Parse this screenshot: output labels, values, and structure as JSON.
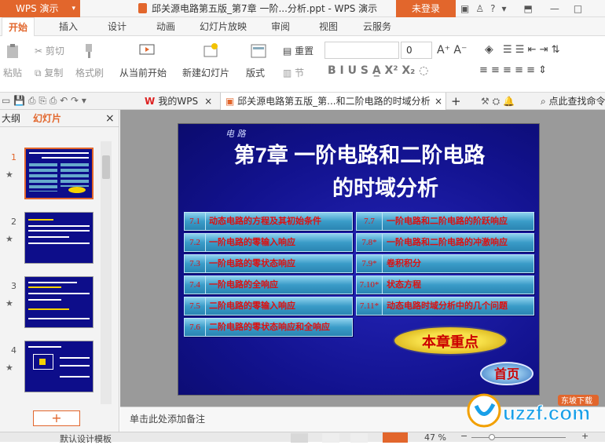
{
  "app": {
    "name": "WPS 演示",
    "doc_title": "邱关源电路第五版_第7章 一阶...分析.ppt - WPS 演示",
    "login": "未登录"
  },
  "menu": {
    "tabs": [
      "开始",
      "插入",
      "设计",
      "动画",
      "幻灯片放映",
      "审阅",
      "视图",
      "云服务"
    ]
  },
  "ribbon": {
    "paste": "粘贴",
    "cut": "剪切",
    "copy": "复制",
    "format_painter": "格式刷",
    "from_current": "从当前开始",
    "new_slide": "新建幻灯片",
    "layout": "版式",
    "reset": "重置",
    "section": "节",
    "font_name": "",
    "font_size": "0"
  },
  "quickbar": {
    "tab_wps": "我的WPS",
    "tab_doc": "邱关源电路第五版_第...和二阶电路的时域分析",
    "search": "点此查找命令"
  },
  "left_panel": {
    "tab_outline": "大纲",
    "tab_slides": "幻灯片",
    "slide_numbers": [
      "1",
      "2",
      "3",
      "4"
    ],
    "star": "★",
    "add": "+"
  },
  "slide": {
    "deco": "电 路",
    "title_line1": "第7章 一阶电路和二阶电路",
    "title_line2": "的时域分析",
    "left_items": [
      {
        "num": "7.1",
        "label": "动态电路的方程及其初始条件"
      },
      {
        "num": "7.2",
        "label": "一阶电路的零输入响应"
      },
      {
        "num": "7.3",
        "label": "一阶电路的零状态响应"
      },
      {
        "num": "7.4",
        "label": "一阶电路的全响应"
      },
      {
        "num": "7.5",
        "label": "二阶电路的零输入响应"
      },
      {
        "num": "7.6",
        "label": "二阶电路的零状态响应和全响应"
      }
    ],
    "right_items": [
      {
        "num": "7.7",
        "label": "一阶电路和二阶电路的阶跃响应"
      },
      {
        "num": "7.8*",
        "label": "一阶电路和二阶电路的冲激响应"
      },
      {
        "num": "7.9*",
        "label": "卷积积分"
      },
      {
        "num": "7.10*",
        "label": "状态方程"
      },
      {
        "num": "7.11*",
        "label": "动态电路时域分析中的几个问题"
      }
    ],
    "key_points": "本章重点",
    "home": "首页"
  },
  "notes": {
    "placeholder": "单击此处添加备注"
  },
  "status": {
    "template": "默认设计模板",
    "zoom": "47 %"
  },
  "watermark": {
    "text": "uzzf.com",
    "sub": "东坡下载"
  }
}
